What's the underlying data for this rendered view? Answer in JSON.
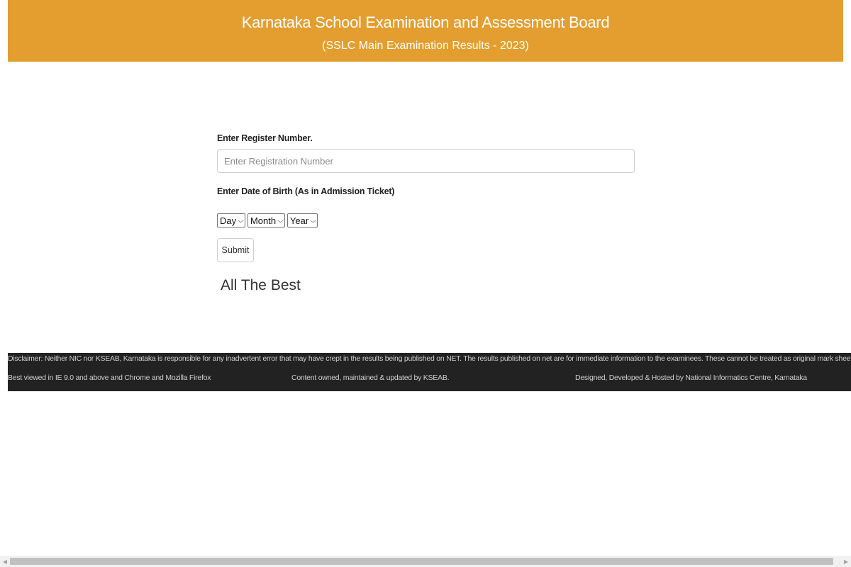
{
  "header": {
    "title": "Karnataka School Examination and Assessment Board",
    "subtitle": "(SSLC Main Examination Results - 2023)",
    "background_color": "#e39e2f"
  },
  "form": {
    "register_label": "Enter Register Number.",
    "register_placeholder": "Enter Registration Number",
    "register_value": "",
    "dob_label": "Enter Date of Birth (As in Admission Ticket)",
    "day_select": "Day",
    "month_select": "Month",
    "year_select": "Year",
    "submit_label": "Submit",
    "message": "All The Best"
  },
  "footer": {
    "disclaimer": "Disclaimer: Neither NIC  nor KSEAB, Karnataka is responsible for any inadvertent error that may have crept in the results being published on NET. The results published on net are for immediate information to the examinees. These cannot be treated as original mark sheets.",
    "browser_note": "Best viewed in IE 9.0 and above and Chrome and Mozilla Firefox",
    "content_note": "Content owned, maintained & updated by KSEAB.",
    "hosting_note": "Designed, Developed & Hosted by National Informatics Centre, Karnataka",
    "background_color": "#222222"
  },
  "icons": {
    "dropdown": "chevron-down-icon",
    "scroll_left": "arrow-left-icon",
    "scroll_right": "arrow-right-icon"
  }
}
